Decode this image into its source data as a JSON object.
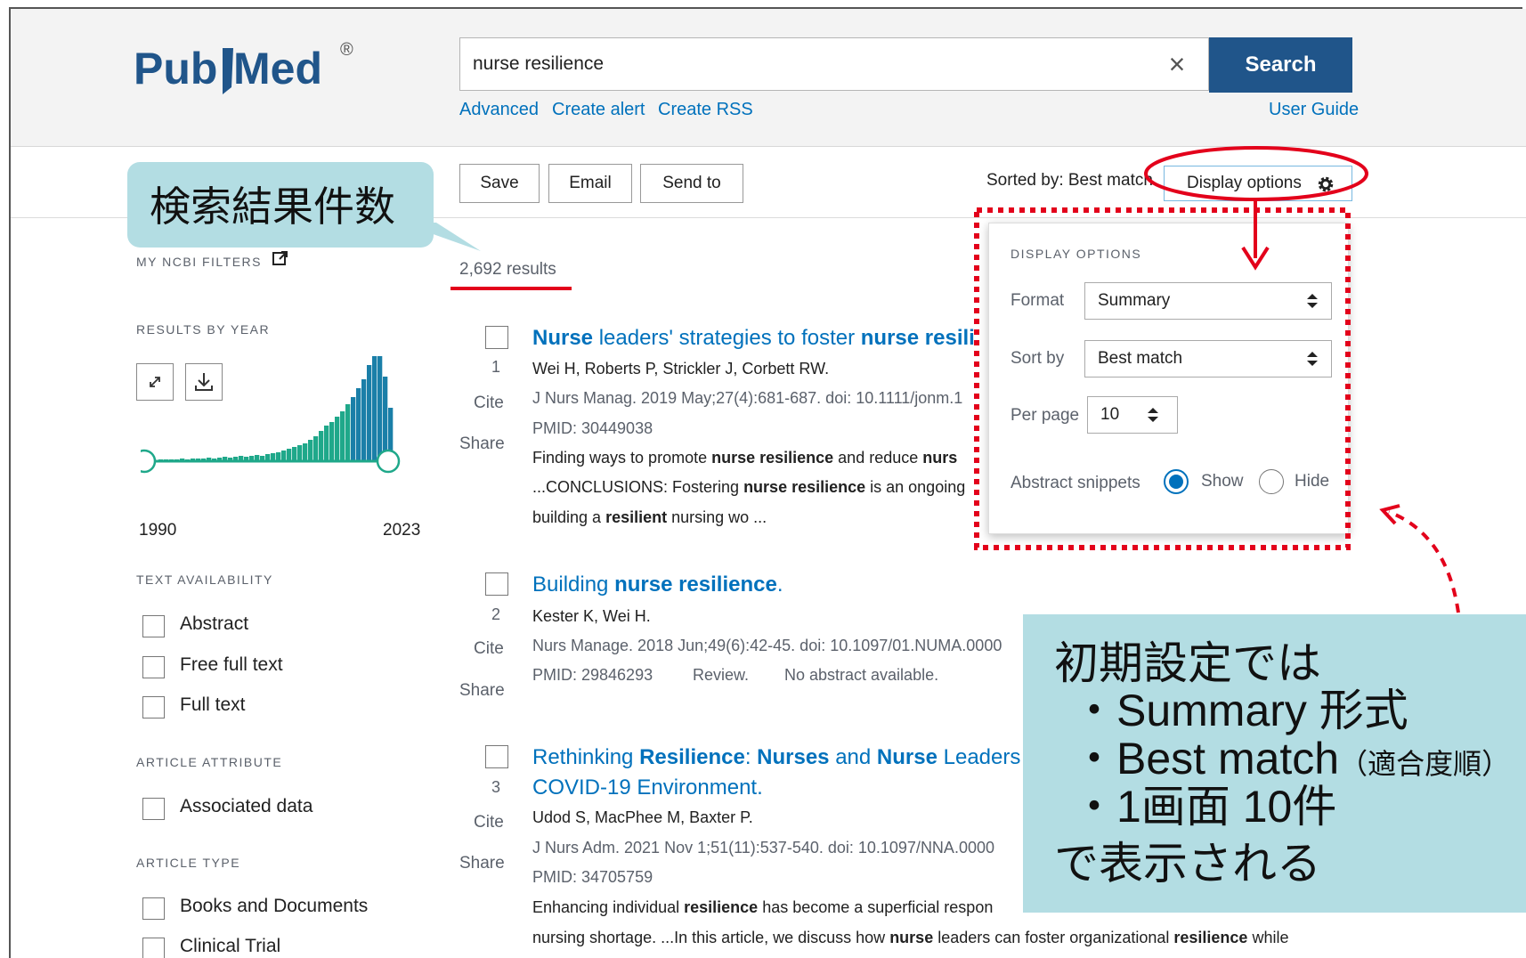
{
  "header": {
    "logo_text": "PubMed",
    "logo_mark": "®",
    "search_value": "nurse resilience",
    "clear_icon": "×",
    "search_label": "Search",
    "links": [
      "Advanced",
      "Create alert",
      "Create RSS"
    ],
    "user_guide": "User Guide"
  },
  "toolbar": {
    "save": "Save",
    "email": "Email",
    "send_to": "Send to",
    "sorted_by": "Sorted by: Best match",
    "display_options": "Display options"
  },
  "sidebar": {
    "my_ncbi_filters": "MY NCBI FILTERS",
    "results_by_year": "RESULTS BY YEAR",
    "year_start": "1990",
    "year_end": "2023",
    "text_availability": "TEXT AVAILABILITY",
    "text_filters": [
      "Abstract",
      "Free full text",
      "Full text"
    ],
    "article_attribute": "ARTICLE ATTRIBUTE",
    "attribute_filters": [
      "Associated data"
    ],
    "article_type": "ARTICLE TYPE",
    "type_filters": [
      "Books and Documents",
      "Clinical Trial"
    ]
  },
  "results": {
    "count": "2,692 results",
    "cite": "Cite",
    "share": "Share",
    "items": [
      {
        "num": "1",
        "title_parts": [
          [
            "Nurse",
            true
          ],
          [
            " leaders' strategies to foster ",
            false
          ],
          [
            "nurse resili",
            true
          ]
        ],
        "authors": "Wei H, Roberts P, Strickler J, Corbett RW.",
        "citation": "J Nurs Manag. 2019 May;27(4):681-687. doi: 10.1111/jonm.1",
        "pmid": "PMID: 30449038",
        "snippet1": [
          [
            "Finding ways to promote ",
            false
          ],
          [
            "nurse resilience",
            true
          ],
          [
            " and reduce ",
            false
          ],
          [
            "nurs",
            true
          ]
        ],
        "snippet2": [
          [
            "...CONCLUSIONS: Fostering ",
            false
          ],
          [
            "nurse resilience",
            true
          ],
          [
            " is an ongoing ",
            false
          ]
        ],
        "snippet3": [
          [
            "building a ",
            false
          ],
          [
            "resilient",
            true
          ],
          [
            " nursing wo ...",
            false
          ]
        ]
      },
      {
        "num": "2",
        "title_parts": [
          [
            "Building ",
            false
          ],
          [
            "nurse resilience",
            true
          ],
          [
            ".",
            false
          ]
        ],
        "authors": "Kester K, Wei H.",
        "citation": "Nurs Manage. 2018 Jun;49(6):42-45. doi: 10.1097/01.NUMA.0000",
        "pmid": "PMID: 29846293",
        "extra1": "Review.",
        "extra2": "No abstract available."
      },
      {
        "num": "3",
        "title_parts": [
          [
            "Rethinking ",
            false
          ],
          [
            "Resilience",
            true
          ],
          [
            ": ",
            false
          ],
          [
            "Nurses",
            true
          ],
          [
            " and ",
            false
          ],
          [
            "Nurse",
            true
          ],
          [
            " Leaders",
            false
          ]
        ],
        "title_line2": "COVID-19 Environment.",
        "authors": "Udod S, MacPhee M, Baxter P.",
        "citation": "J Nurs Adm. 2021 Nov 1;51(11):537-540. doi: 10.1097/NNA.0000",
        "pmid": "PMID: 34705759",
        "snippet1": [
          [
            "Enhancing individual ",
            false
          ],
          [
            "resilience",
            true
          ],
          [
            " has become a superficial respon",
            false
          ]
        ],
        "snippet2": [
          [
            "nursing shortage. ...In this article, we discuss how ",
            false
          ],
          [
            "nurse",
            true
          ],
          [
            " leaders can foster organizational ",
            false
          ],
          [
            "resilience",
            true
          ],
          [
            " while",
            false
          ]
        ]
      }
    ]
  },
  "display_panel": {
    "heading": "DISPLAY OPTIONS",
    "format_label": "Format",
    "format_value": "Summary",
    "sort_label": "Sort by",
    "sort_value": "Best match",
    "per_page_label": "Per page",
    "per_page_value": "10",
    "snippets_label": "Abstract snippets",
    "show": "Show",
    "hide": "Hide"
  },
  "annotations": {
    "count_callout": "検索結果件数",
    "defaults_line1": "初期設定では",
    "defaults_line2": "・Summary 形式",
    "defaults_line3": "・Best match",
    "defaults_line3_small": "（適合度順）",
    "defaults_line4": "・1画面 10件",
    "defaults_line5": "で表示される"
  },
  "colors": {
    "link": "#0071bc",
    "search_button": "#20558a",
    "annotation_red": "#e3001b",
    "callout_bg": "#b3dde3",
    "histogram": "#1fa88a"
  }
}
